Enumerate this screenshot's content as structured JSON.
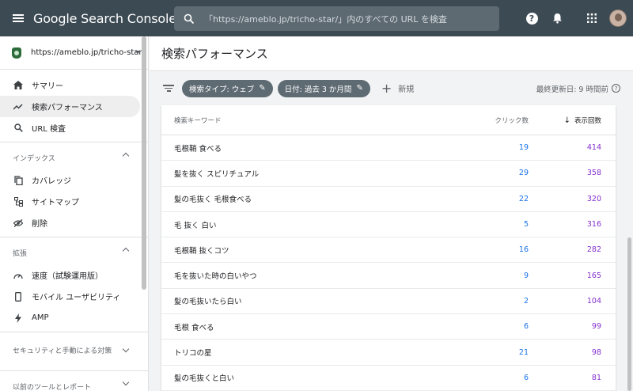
{
  "app": {
    "title": "Google Search Console"
  },
  "search": {
    "placeholder": "「https://ameblo.jp/tricho-star/」内のすべての URL を検査"
  },
  "property": {
    "label": "https://ameblo.jp/tricho-star/"
  },
  "sidebar": {
    "top_items": [
      {
        "label": "サマリー",
        "icon": "home-icon"
      },
      {
        "label": "検索パフォーマンス",
        "icon": "trending-icon"
      },
      {
        "label": "URL 検査",
        "icon": "search-icon"
      }
    ],
    "index_section": {
      "title": "インデックス",
      "items": [
        {
          "label": "カバレッジ",
          "icon": "copy-icon"
        },
        {
          "label": "サイトマップ",
          "icon": "sitemap-icon"
        },
        {
          "label": "削除",
          "icon": "eye-off-icon"
        }
      ]
    },
    "enhance_section": {
      "title": "拡張",
      "items": [
        {
          "label": "速度（試験運用版）",
          "icon": "speed-icon"
        },
        {
          "label": "モバイル ユーザビリティ",
          "icon": "phone-icon"
        },
        {
          "label": "AMP",
          "icon": "bolt-icon"
        }
      ]
    },
    "security_section": {
      "title": "セキュリティと手動による対策"
    },
    "legacy_section": {
      "title": "以前のツールとレポート"
    }
  },
  "page": {
    "title": "検索パフォーマンス"
  },
  "filters": {
    "chips": [
      "検索タイプ: ウェブ",
      "日付: 過去 3 か月間"
    ],
    "new_label": "新規",
    "updated": "最終更新日: 9 時間前"
  },
  "table": {
    "columns": {
      "keyword": "検索キーワード",
      "clicks": "クリック数",
      "impressions": "表示回数"
    },
    "rows": [
      {
        "keyword": "毛根鞘 食べる",
        "clicks": "19",
        "impressions": "414"
      },
      {
        "keyword": "髪を抜く スピリチュアル",
        "clicks": "29",
        "impressions": "358"
      },
      {
        "keyword": "髪の毛抜く 毛根食べる",
        "clicks": "22",
        "impressions": "320"
      },
      {
        "keyword": "毛 抜く 白い",
        "clicks": "5",
        "impressions": "316"
      },
      {
        "keyword": "毛根鞘 抜くコツ",
        "clicks": "16",
        "impressions": "282"
      },
      {
        "keyword": "毛を抜いた時の白いやつ",
        "clicks": "9",
        "impressions": "165"
      },
      {
        "keyword": "髪の毛抜いたら白い",
        "clicks": "2",
        "impressions": "104"
      },
      {
        "keyword": "毛根 食べる",
        "clicks": "6",
        "impressions": "99"
      },
      {
        "keyword": "トリコの星",
        "clicks": "21",
        "impressions": "98"
      },
      {
        "keyword": "髪の毛抜くと白い",
        "clicks": "6",
        "impressions": "81"
      }
    ]
  },
  "colors": {
    "topbar": "#3c4a53",
    "clicks": "#1a73e8",
    "impressions": "#8430ce"
  }
}
